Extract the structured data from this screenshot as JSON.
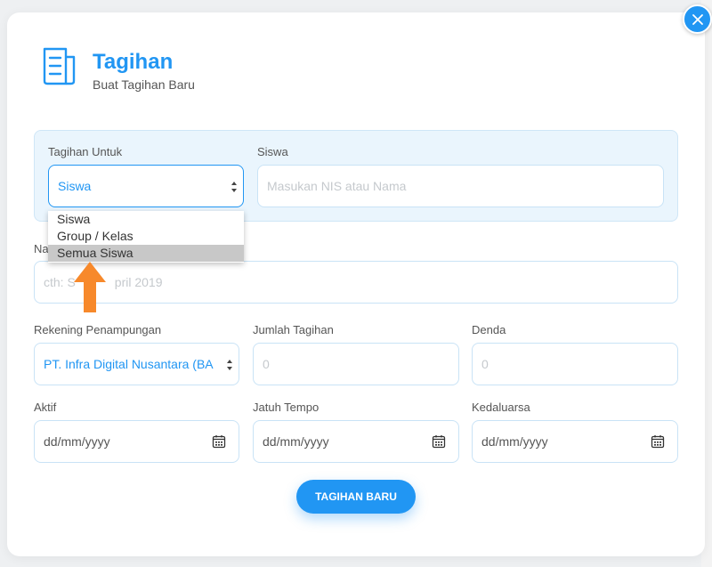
{
  "header": {
    "title": "Tagihan",
    "subtitle": "Buat Tagihan Baru",
    "icon": "document-icon"
  },
  "close": {
    "icon": "close-icon"
  },
  "target_section": {
    "tagihan_untuk_label": "Tagihan Untuk",
    "tagihan_untuk_value": "Siswa",
    "siswa_label": "Siswa",
    "siswa_placeholder": "Masukan NIS atau Nama"
  },
  "dropdown": {
    "options": [
      "Siswa",
      "Group / Kelas",
      "Semua Siswa"
    ],
    "highlighted": "Semua Siswa"
  },
  "nama": {
    "label_visible": "Na",
    "placeholder_left": "cth: S",
    "placeholder_right": "pril 2019"
  },
  "rekening": {
    "label": "Rekening Penampungan",
    "value": "PT. Infra Digital Nusantara (BA"
  },
  "jumlah": {
    "label": "Jumlah Tagihan",
    "placeholder": "0"
  },
  "denda": {
    "label": "Denda",
    "placeholder": "0"
  },
  "aktif": {
    "label": "Aktif",
    "placeholder": "dd/mm/yyyy"
  },
  "jatuh_tempo": {
    "label": "Jatuh Tempo",
    "placeholder": "dd/mm/yyyy"
  },
  "kedaluarsa": {
    "label": "Kedaluarsa",
    "placeholder": "dd/mm/yyyy"
  },
  "submit": {
    "label": "TAGIHAN BARU"
  },
  "colors": {
    "accent": "#2196f3",
    "panel_bg": "#eaf5fd",
    "pointer_arrow": "#f7892b",
    "highlight": "#c8c8c8"
  }
}
